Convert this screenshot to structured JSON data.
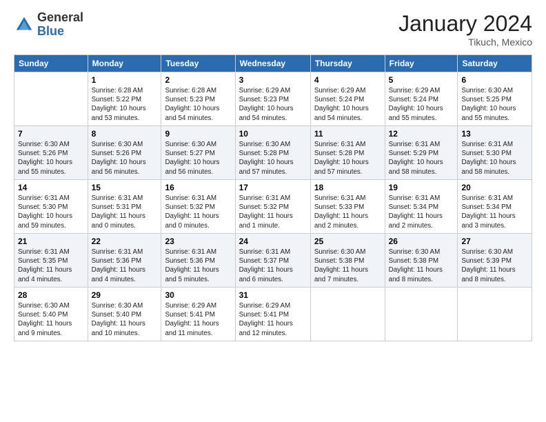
{
  "logo": {
    "general": "General",
    "blue": "Blue"
  },
  "header": {
    "month": "January 2024",
    "location": "Tikuch, Mexico"
  },
  "days_of_week": [
    "Sunday",
    "Monday",
    "Tuesday",
    "Wednesday",
    "Thursday",
    "Friday",
    "Saturday"
  ],
  "weeks": [
    [
      {
        "num": "",
        "info": ""
      },
      {
        "num": "1",
        "info": "Sunrise: 6:28 AM\nSunset: 5:22 PM\nDaylight: 10 hours\nand 53 minutes."
      },
      {
        "num": "2",
        "info": "Sunrise: 6:28 AM\nSunset: 5:23 PM\nDaylight: 10 hours\nand 54 minutes."
      },
      {
        "num": "3",
        "info": "Sunrise: 6:29 AM\nSunset: 5:23 PM\nDaylight: 10 hours\nand 54 minutes."
      },
      {
        "num": "4",
        "info": "Sunrise: 6:29 AM\nSunset: 5:24 PM\nDaylight: 10 hours\nand 54 minutes."
      },
      {
        "num": "5",
        "info": "Sunrise: 6:29 AM\nSunset: 5:24 PM\nDaylight: 10 hours\nand 55 minutes."
      },
      {
        "num": "6",
        "info": "Sunrise: 6:30 AM\nSunset: 5:25 PM\nDaylight: 10 hours\nand 55 minutes."
      }
    ],
    [
      {
        "num": "7",
        "info": "Sunrise: 6:30 AM\nSunset: 5:26 PM\nDaylight: 10 hours\nand 55 minutes."
      },
      {
        "num": "8",
        "info": "Sunrise: 6:30 AM\nSunset: 5:26 PM\nDaylight: 10 hours\nand 56 minutes."
      },
      {
        "num": "9",
        "info": "Sunrise: 6:30 AM\nSunset: 5:27 PM\nDaylight: 10 hours\nand 56 minutes."
      },
      {
        "num": "10",
        "info": "Sunrise: 6:30 AM\nSunset: 5:28 PM\nDaylight: 10 hours\nand 57 minutes."
      },
      {
        "num": "11",
        "info": "Sunrise: 6:31 AM\nSunset: 5:28 PM\nDaylight: 10 hours\nand 57 minutes."
      },
      {
        "num": "12",
        "info": "Sunrise: 6:31 AM\nSunset: 5:29 PM\nDaylight: 10 hours\nand 58 minutes."
      },
      {
        "num": "13",
        "info": "Sunrise: 6:31 AM\nSunset: 5:30 PM\nDaylight: 10 hours\nand 58 minutes."
      }
    ],
    [
      {
        "num": "14",
        "info": "Sunrise: 6:31 AM\nSunset: 5:30 PM\nDaylight: 10 hours\nand 59 minutes."
      },
      {
        "num": "15",
        "info": "Sunrise: 6:31 AM\nSunset: 5:31 PM\nDaylight: 11 hours\nand 0 minutes."
      },
      {
        "num": "16",
        "info": "Sunrise: 6:31 AM\nSunset: 5:32 PM\nDaylight: 11 hours\nand 0 minutes."
      },
      {
        "num": "17",
        "info": "Sunrise: 6:31 AM\nSunset: 5:32 PM\nDaylight: 11 hours\nand 1 minute."
      },
      {
        "num": "18",
        "info": "Sunrise: 6:31 AM\nSunset: 5:33 PM\nDaylight: 11 hours\nand 2 minutes."
      },
      {
        "num": "19",
        "info": "Sunrise: 6:31 AM\nSunset: 5:34 PM\nDaylight: 11 hours\nand 2 minutes."
      },
      {
        "num": "20",
        "info": "Sunrise: 6:31 AM\nSunset: 5:34 PM\nDaylight: 11 hours\nand 3 minutes."
      }
    ],
    [
      {
        "num": "21",
        "info": "Sunrise: 6:31 AM\nSunset: 5:35 PM\nDaylight: 11 hours\nand 4 minutes."
      },
      {
        "num": "22",
        "info": "Sunrise: 6:31 AM\nSunset: 5:36 PM\nDaylight: 11 hours\nand 4 minutes."
      },
      {
        "num": "23",
        "info": "Sunrise: 6:31 AM\nSunset: 5:36 PM\nDaylight: 11 hours\nand 5 minutes."
      },
      {
        "num": "24",
        "info": "Sunrise: 6:31 AM\nSunset: 5:37 PM\nDaylight: 11 hours\nand 6 minutes."
      },
      {
        "num": "25",
        "info": "Sunrise: 6:30 AM\nSunset: 5:38 PM\nDaylight: 11 hours\nand 7 minutes."
      },
      {
        "num": "26",
        "info": "Sunrise: 6:30 AM\nSunset: 5:38 PM\nDaylight: 11 hours\nand 8 minutes."
      },
      {
        "num": "27",
        "info": "Sunrise: 6:30 AM\nSunset: 5:39 PM\nDaylight: 11 hours\nand 8 minutes."
      }
    ],
    [
      {
        "num": "28",
        "info": "Sunrise: 6:30 AM\nSunset: 5:40 PM\nDaylight: 11 hours\nand 9 minutes."
      },
      {
        "num": "29",
        "info": "Sunrise: 6:30 AM\nSunset: 5:40 PM\nDaylight: 11 hours\nand 10 minutes."
      },
      {
        "num": "30",
        "info": "Sunrise: 6:29 AM\nSunset: 5:41 PM\nDaylight: 11 hours\nand 11 minutes."
      },
      {
        "num": "31",
        "info": "Sunrise: 6:29 AM\nSunset: 5:41 PM\nDaylight: 11 hours\nand 12 minutes."
      },
      {
        "num": "",
        "info": ""
      },
      {
        "num": "",
        "info": ""
      },
      {
        "num": "",
        "info": ""
      }
    ]
  ]
}
